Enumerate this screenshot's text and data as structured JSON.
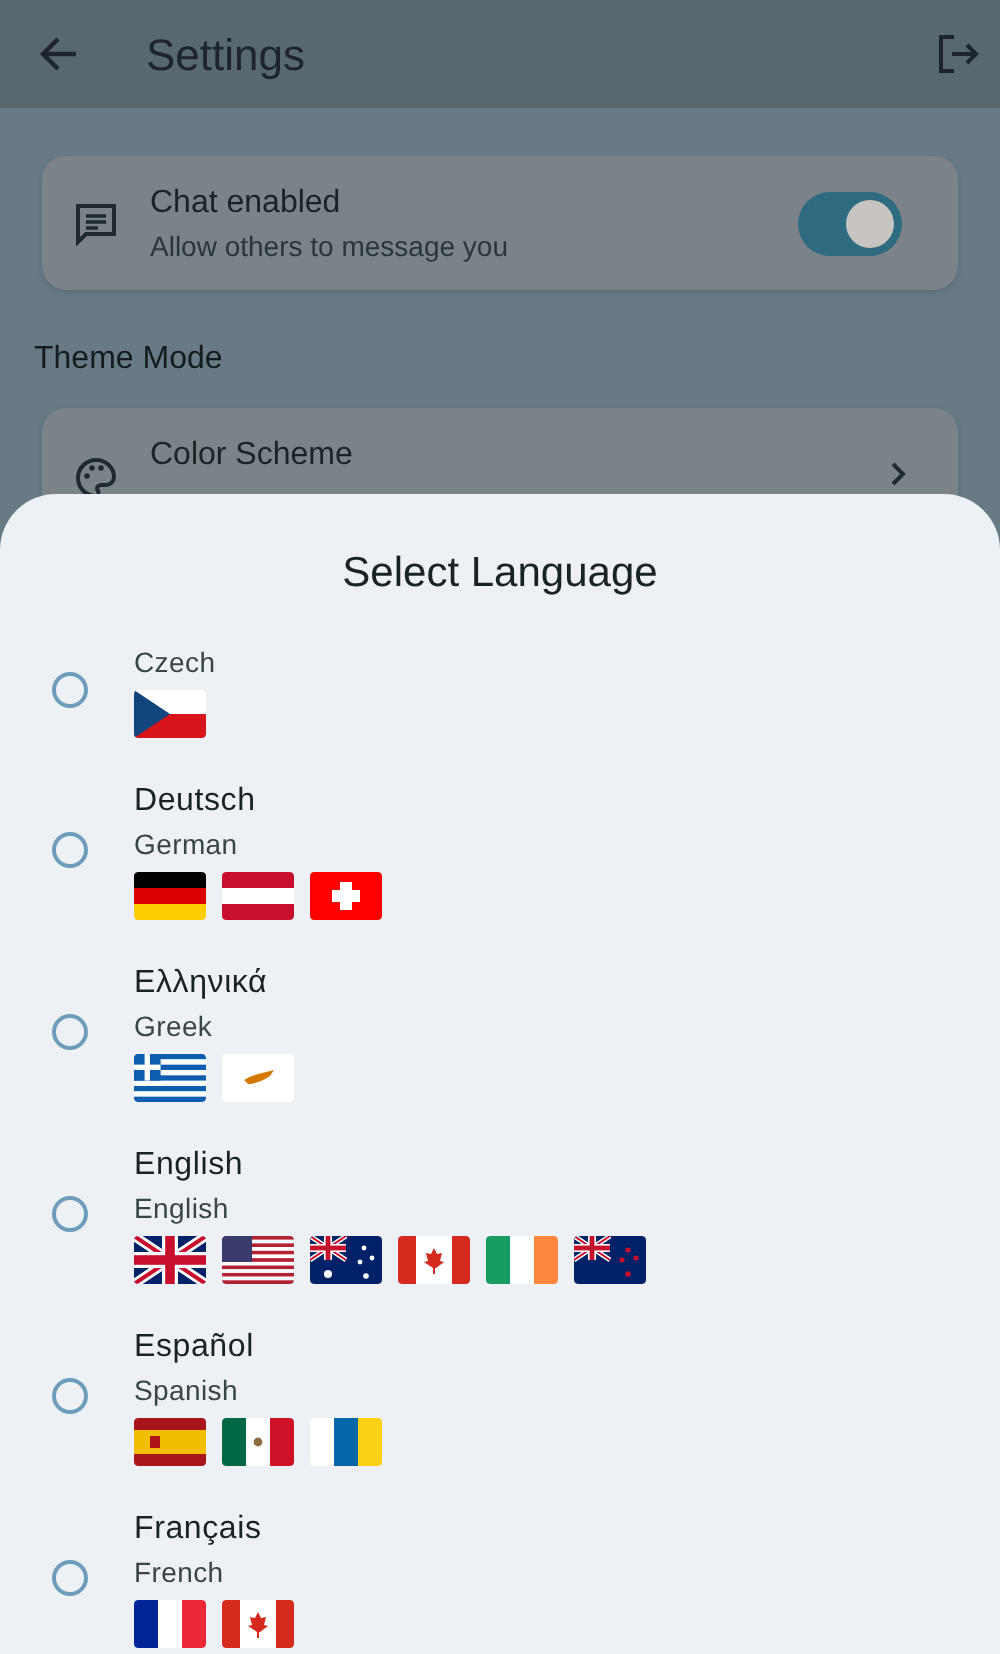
{
  "app_bar": {
    "title": "Settings"
  },
  "sections": [
    {
      "items": [
        {
          "kind": "toggle",
          "title": "Chat enabled",
          "subtitle": "Allow others to message you",
          "on": true
        }
      ]
    },
    {
      "title": "Theme Mode",
      "items": [
        {
          "kind": "link",
          "title": "Color Scheme"
        }
      ]
    }
  ],
  "sheet": {
    "title": "Select Language",
    "languages": [
      {
        "subtitle": "Czech",
        "selected": false,
        "flags": [
          {
            "kind": "czech"
          }
        ]
      },
      {
        "title": "Deutsch",
        "subtitle": "German",
        "selected": false,
        "flags": [
          {
            "kind": "germany"
          },
          {
            "kind": "austria"
          },
          {
            "kind": "switzerland"
          }
        ]
      },
      {
        "title": "Ελληνικά",
        "subtitle": "Greek",
        "selected": false,
        "flags": [
          {
            "kind": "greece"
          },
          {
            "kind": "cyprus"
          }
        ]
      },
      {
        "title": "English",
        "subtitle": "English",
        "selected": false,
        "flags": [
          {
            "kind": "uk"
          },
          {
            "kind": "usa"
          },
          {
            "kind": "australia"
          },
          {
            "kind": "canada"
          },
          {
            "kind": "ireland"
          },
          {
            "kind": "newzealand"
          }
        ]
      },
      {
        "title": "Español",
        "subtitle": "Spanish",
        "selected": false,
        "flags": [
          {
            "kind": "spain"
          },
          {
            "kind": "mexico"
          },
          {
            "kind": "canary"
          }
        ]
      },
      {
        "title": "Français",
        "subtitle": "French",
        "selected": false,
        "flags": [
          {
            "kind": "france"
          },
          {
            "kind": "canada"
          }
        ]
      }
    ]
  }
}
